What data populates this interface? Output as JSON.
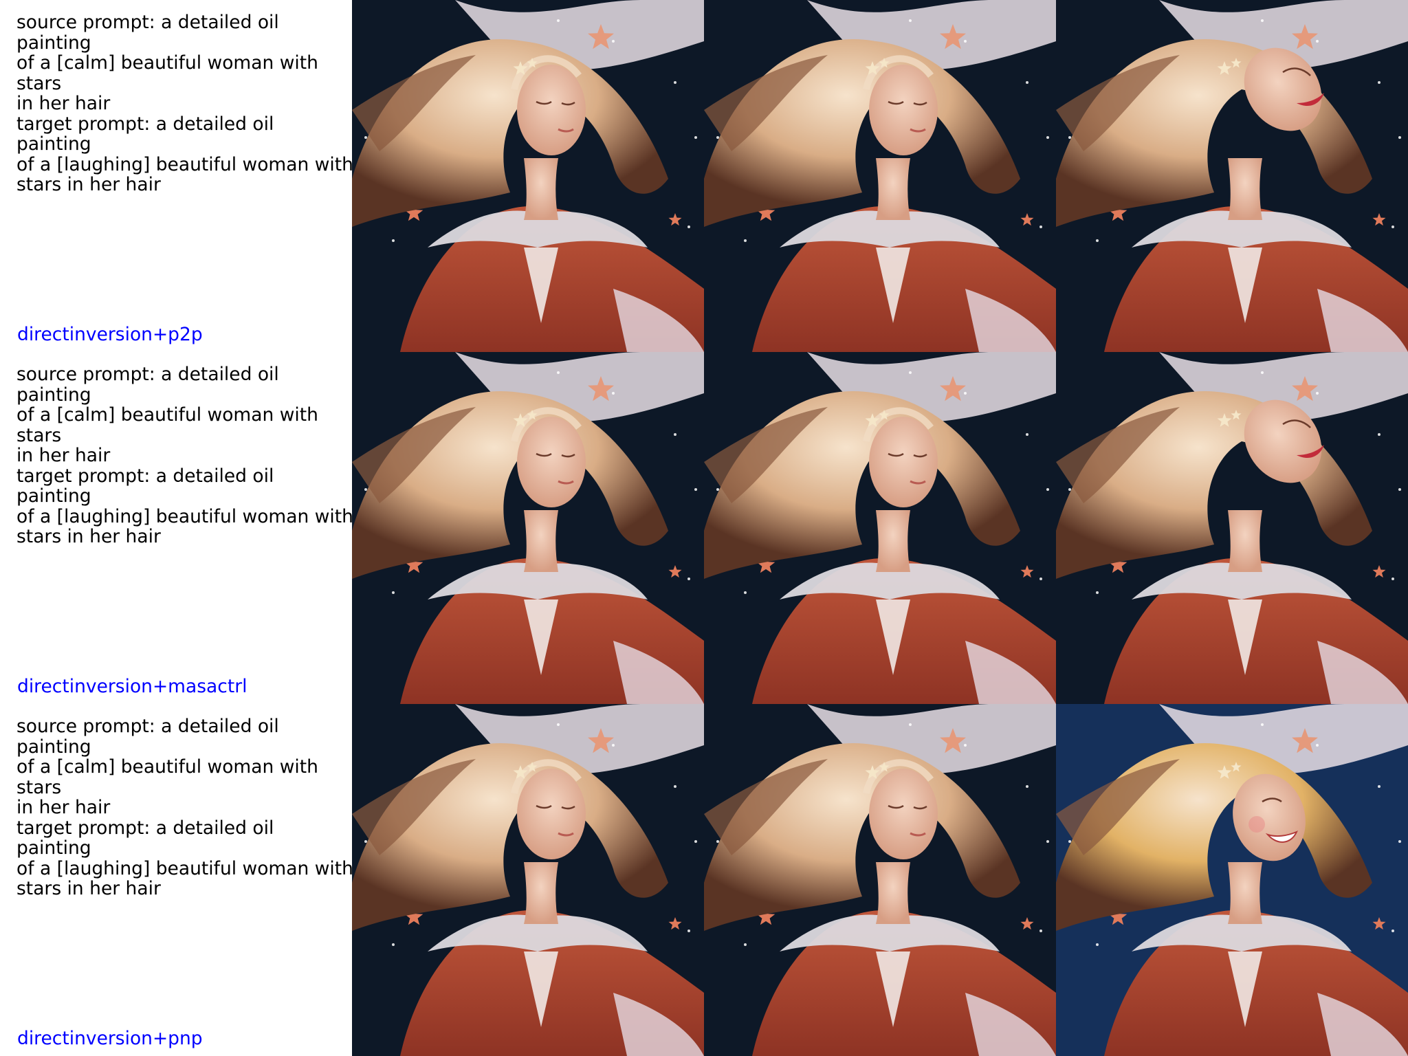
{
  "rows": [
    {
      "caption": {
        "source_line1": "source prompt: a detailed oil painting",
        "source_line2": "of a [calm] beautiful woman with stars",
        "source_line3": "in her hair",
        "target_line1": "target prompt: a detailed oil painting",
        "target_line2": "of a [laughing] beautiful woman with",
        "target_line3": "stars in her hair"
      },
      "method_label": "directinversion+p2p"
    },
    {
      "caption": {
        "source_line1": "source prompt: a detailed oil painting",
        "source_line2": "of a [calm] beautiful woman with stars",
        "source_line3": "in her hair",
        "target_line1": "target prompt: a detailed oil painting",
        "target_line2": "of a [laughing] beautiful woman with",
        "target_line3": "stars in her hair"
      },
      "method_label": "directinversion+masactrl"
    },
    {
      "caption": {
        "source_line1": "source prompt: a detailed oil painting",
        "source_line2": "of a [calm] beautiful woman with stars",
        "source_line3": "in her hair",
        "target_line1": "target prompt: a detailed oil painting",
        "target_line2": "of a [laughing] beautiful woman with",
        "target_line3": "stars in her hair"
      },
      "method_label": "directinversion+pnp"
    }
  ],
  "colors": {
    "caption_text": "#000000",
    "method_label": "#0000ff",
    "night_sky": "#0d1827",
    "hair": "#d9ad86",
    "dress": "#c0563a",
    "ruffle": "#dcd9de"
  }
}
